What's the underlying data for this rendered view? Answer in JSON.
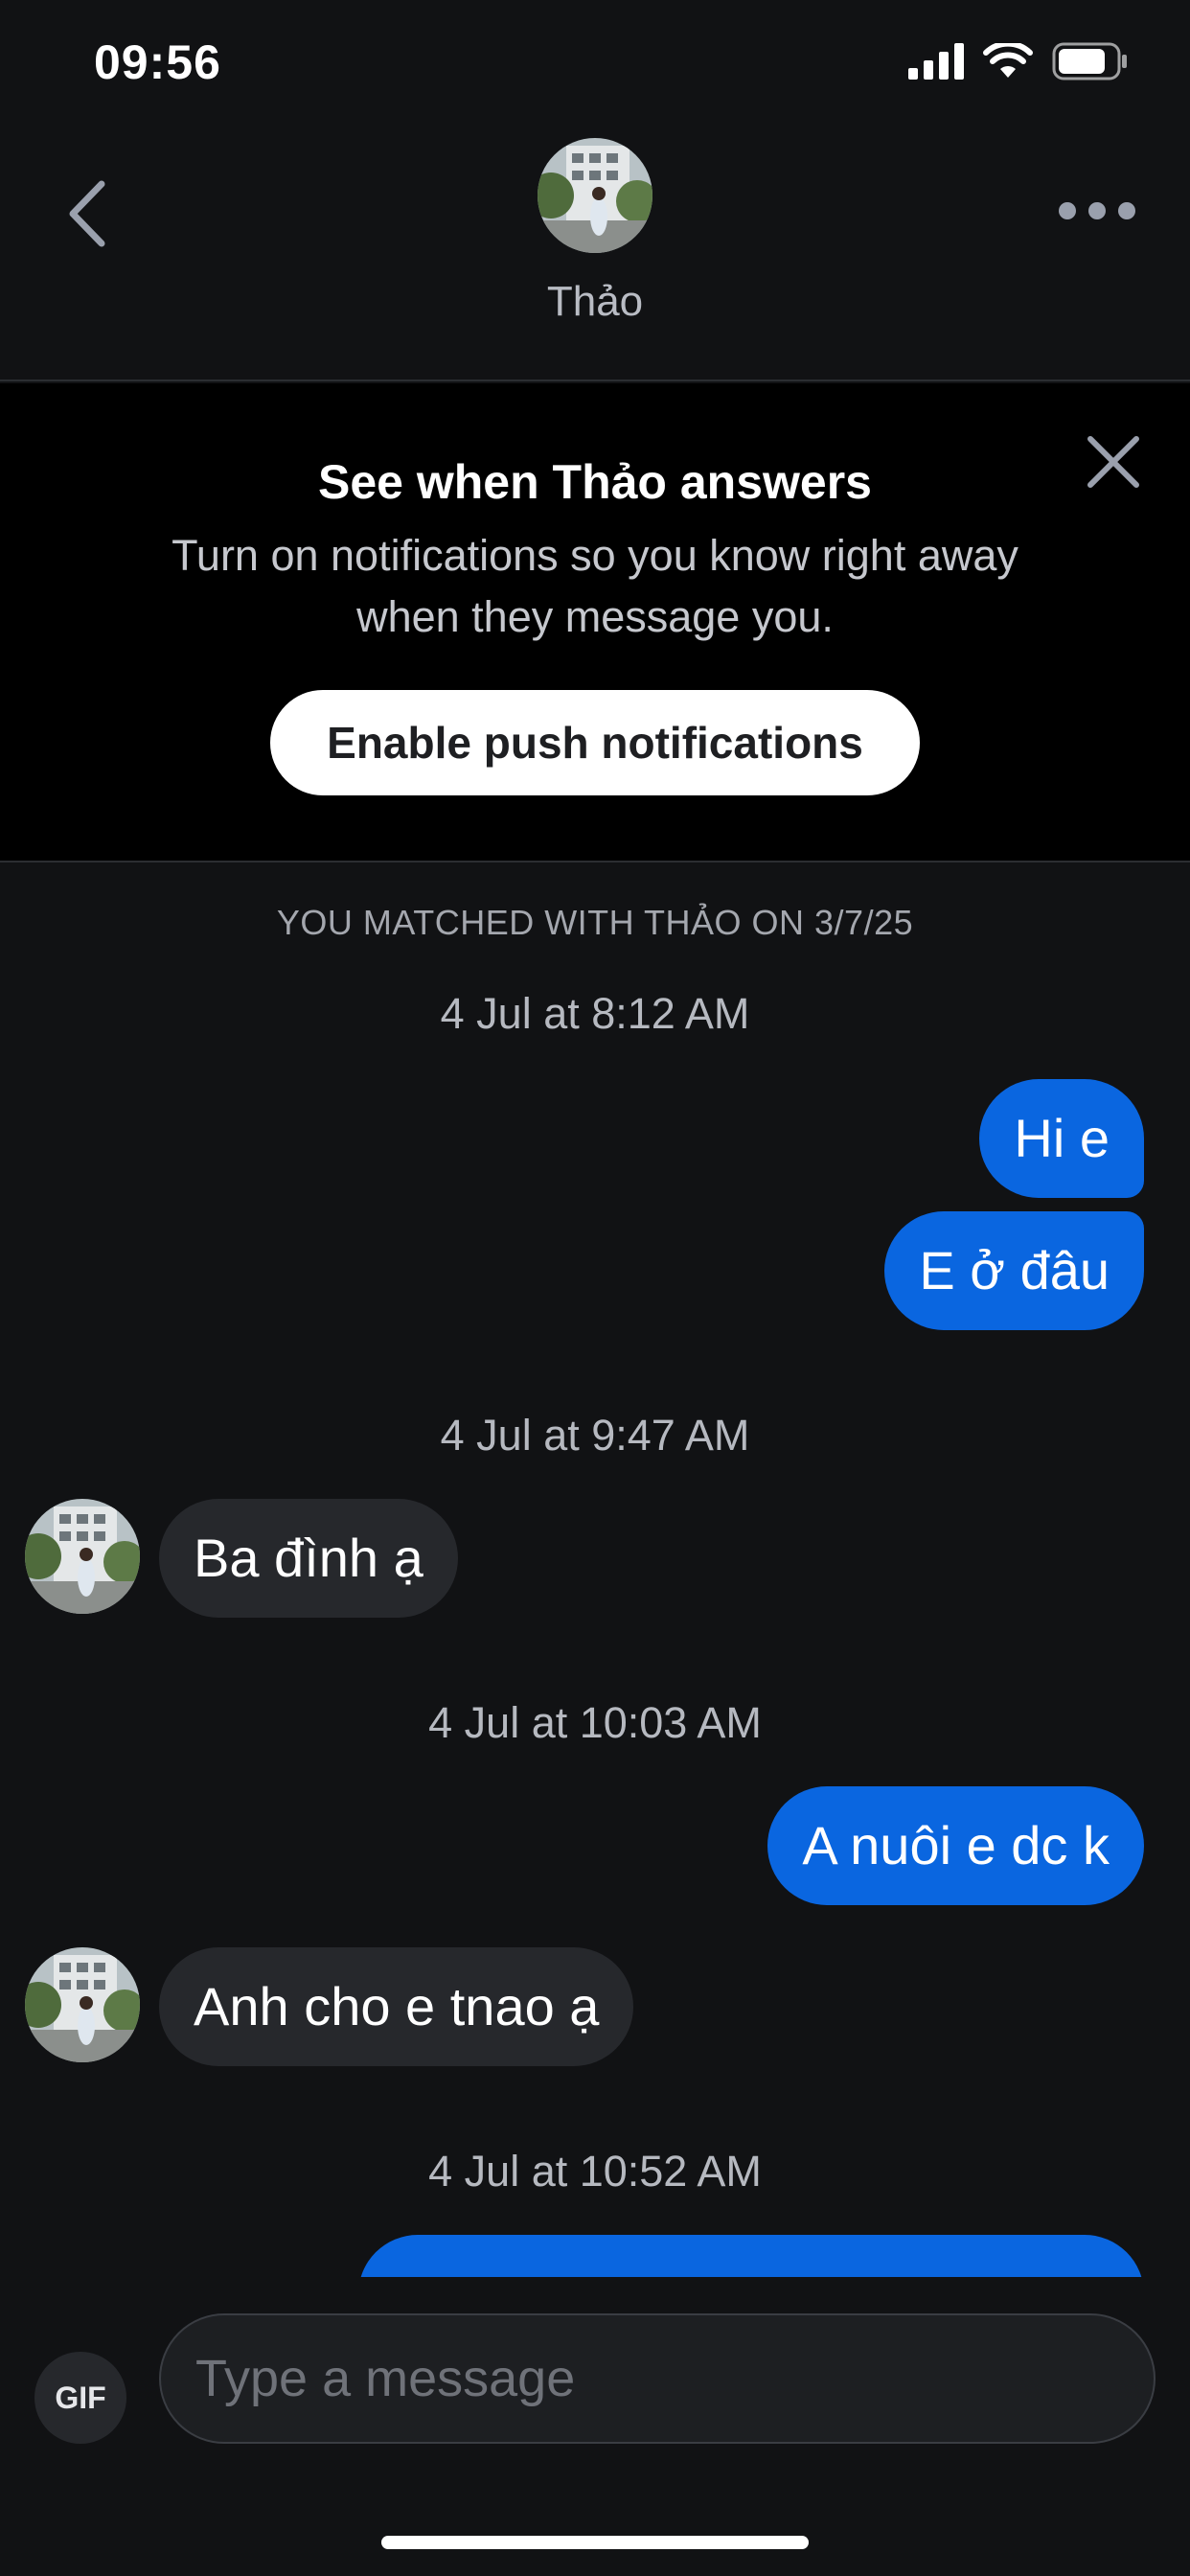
{
  "status_bar": {
    "time": "09:56",
    "icons": [
      "cellular-signal-icon",
      "wifi-icon",
      "battery-icon"
    ]
  },
  "header": {
    "back_icon": "chevron-left-icon",
    "more_icon": "more-horizontal-icon",
    "name": "Thảo"
  },
  "banner": {
    "title": "See when Thảo answers",
    "text": "Turn on notifications so you know right away when they message you.",
    "button_label": "Enable push notifications",
    "close_icon": "close-icon"
  },
  "chat": {
    "match_line": "YOU MATCHED WITH THẢO ON 3/7/25",
    "timestamps": [
      "4 Jul at 8:12 AM",
      "4 Jul at 9:47 AM",
      "4 Jul at 10:03 AM",
      "4 Jul at 10:52 AM"
    ],
    "messages": [
      {
        "direction": "out",
        "text": "Hi e"
      },
      {
        "direction": "out",
        "text": "E ở đâu"
      },
      {
        "direction": "in",
        "text": "Ba đình ạ"
      },
      {
        "direction": "out",
        "text": "A nuôi e dc k"
      },
      {
        "direction": "in",
        "text": "Anh cho e tnao ạ"
      }
    ]
  },
  "composer": {
    "gif_label": "GIF",
    "placeholder": "Type a message"
  },
  "colors": {
    "background": "#111214",
    "outgoing_bubble": "#0a66e0",
    "incoming_bubble": "#26282c",
    "banner_background": "#000000"
  }
}
